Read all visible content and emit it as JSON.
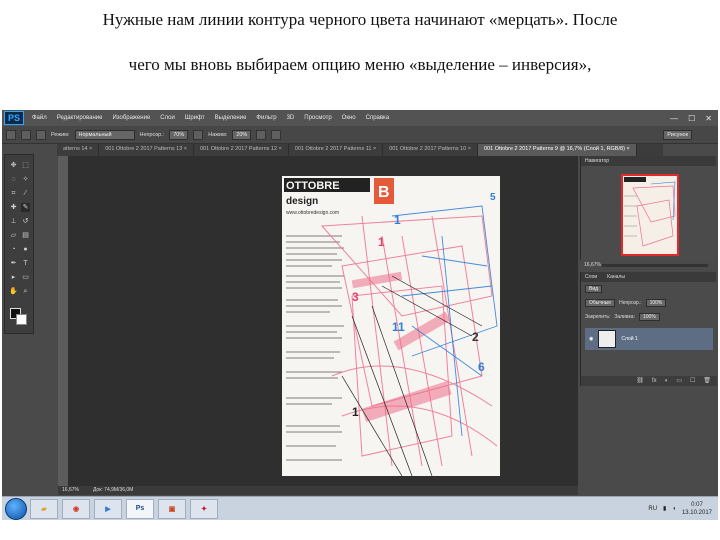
{
  "caption": {
    "line1": "Нужные нам линии контура черного цвета начинают «мерцать». После",
    "line2": "чего мы вновь выбираем опцию меню «выделение – инверсия»,"
  },
  "app": {
    "logo": "PS",
    "menu": [
      "Файл",
      "Редактирование",
      "Изображение",
      "Слои",
      "Шрифт",
      "Выделение",
      "Фильтр",
      "3D",
      "Просмотр",
      "Окно",
      "Справка"
    ],
    "window_controls": [
      "—",
      "☐",
      "✕"
    ]
  },
  "options": {
    "mode_label": "Режим:",
    "mode_value": "Нормальный",
    "opacity_label": "Непрозр.:",
    "opacity_value": "70%",
    "flow_label": "Нажим:",
    "flow_value": "20%",
    "workspace": "Рисунок"
  },
  "tabs": [
    {
      "label": "atterns 14 ×"
    },
    {
      "label": "001 Ottobre 2 2017 Patterns 13 ×"
    },
    {
      "label": "001 Ottobre 2 2017 Patterns 12 ×"
    },
    {
      "label": "001 Ottobre 2 2017 Patterns 11 ×"
    },
    {
      "label": "001 Ottobre 2 2017 Patterns 10 ×"
    },
    {
      "label": "001 Ottobre 2 2017 Patterns 9 @ 16,7% (Слой 1, RGB/8) ×"
    }
  ],
  "document": {
    "brand_title": "OTTOBRE",
    "brand_sub": "design",
    "brand_badge": "B",
    "website": "www.ottobredesign.com",
    "pattern_numbers": [
      "1",
      "1",
      "3",
      "11",
      "2",
      "6",
      "1",
      "5"
    ]
  },
  "navigator": {
    "title": "Навигатор",
    "zoom": "16,67%"
  },
  "layers": {
    "tabs": [
      "Слои",
      "Каналы"
    ],
    "kind_label": "Вид",
    "blend_mode": "Обычные",
    "opacity_label": "Непрозр.:",
    "opacity_value": "100%",
    "lock_label": "Закрепить:",
    "fill_label": "Заливка:",
    "fill_value": "100%",
    "layer_name": "Слой 1",
    "footer_icons": [
      "⛓",
      "fx",
      "◐",
      "▭",
      "☐",
      "🗑"
    ]
  },
  "status": {
    "zoom": "16,67%",
    "doc_size": "Док: 74,9M/36,0M"
  },
  "taskbar": {
    "apps": [
      "",
      "",
      "",
      "Ps",
      "",
      ""
    ],
    "lang": "RU",
    "time": "0:07",
    "date": "13.10.2017"
  },
  "colors": {
    "accent_red": "#e32a2a",
    "accent_blue": "#2f7fd8",
    "pink_trace": "#ee6f8c"
  }
}
